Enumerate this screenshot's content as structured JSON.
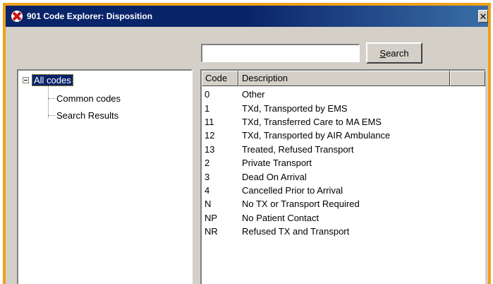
{
  "window": {
    "title": "901 Code Explorer: Disposition",
    "close_label": "✕"
  },
  "search": {
    "value": "",
    "placeholder": "",
    "button_label_underlined": "S",
    "button_label_rest": "earch"
  },
  "tree": {
    "root_label": "All codes",
    "children": [
      {
        "label": "Common codes"
      },
      {
        "label": "Search Results"
      }
    ]
  },
  "list": {
    "columns": [
      "Code",
      "Description"
    ],
    "rows": [
      {
        "code": "0",
        "description": "Other"
      },
      {
        "code": "1",
        "description": "TXd, Transported by EMS"
      },
      {
        "code": "11",
        "description": "TXd, Transferred Care to MA EMS"
      },
      {
        "code": "12",
        "description": "TXd, Transported by AIR Ambulance"
      },
      {
        "code": "13",
        "description": "Treated, Refused Transport"
      },
      {
        "code": "2",
        "description": "Private Transport"
      },
      {
        "code": "3",
        "description": "Dead On Arrival"
      },
      {
        "code": "4",
        "description": "Cancelled Prior to Arrival"
      },
      {
        "code": "N",
        "description": "No TX or Transport Required"
      },
      {
        "code": "NP",
        "description": "No Patient Contact"
      },
      {
        "code": "NR",
        "description": "Refused TX and Transport"
      }
    ]
  },
  "colors": {
    "frame_accent": "#f0a01c",
    "titlebar": "#0a246a",
    "selection": "#0a246a",
    "window_bg": "#d4d0c8"
  }
}
